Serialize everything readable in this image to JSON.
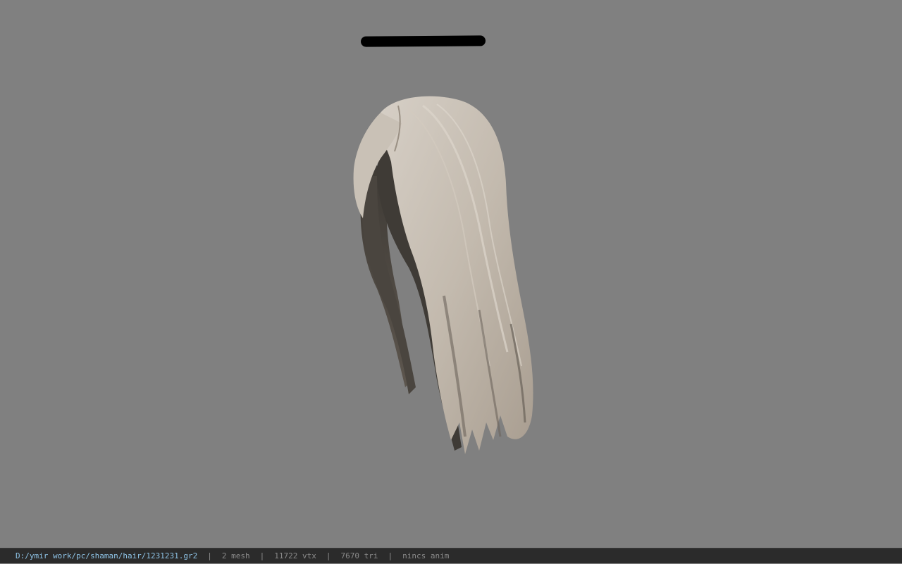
{
  "status_bar": {
    "file_path": "D:/ymir work/pc/shaman/hair/1231231.gr2",
    "separator": "|",
    "mesh_count": "2 mesh",
    "vertex_count": "11722 vtx",
    "triangle_count": "7670 tri",
    "animation": "nincs anim"
  },
  "viewport": {
    "background_color": "#808080",
    "model": "hair-mesh",
    "hair_light_color": "#bfb6aa",
    "hair_shadow_color": "#514b44"
  }
}
